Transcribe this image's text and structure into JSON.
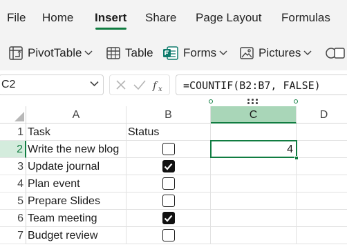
{
  "tabs": [
    {
      "label": "File",
      "active": false
    },
    {
      "label": "Home",
      "active": false
    },
    {
      "label": "Insert",
      "active": true
    },
    {
      "label": "Share",
      "active": false
    },
    {
      "label": "Page Layout",
      "active": false
    },
    {
      "label": "Formulas",
      "active": false
    }
  ],
  "ribbon": {
    "pivot_label": "PivotTable",
    "table_label": "Table",
    "forms_label": "Forms",
    "pictures_label": "Pictures"
  },
  "formula_bar": {
    "name_box": "C2",
    "formula": "=COUNTIF(B2:B7, FALSE)"
  },
  "grid": {
    "columns": [
      "A",
      "B",
      "C",
      "D"
    ],
    "selected_column": "C",
    "rows": [
      {
        "num": "1",
        "a": "Task",
        "b_text": "Status",
        "b_checkbox": null,
        "c": ""
      },
      {
        "num": "2",
        "a": "Write the new blog",
        "b_text": "",
        "b_checkbox": false,
        "c": "4"
      },
      {
        "num": "3",
        "a": "Update journal",
        "b_text": "",
        "b_checkbox": true,
        "c": ""
      },
      {
        "num": "4",
        "a": "Plan event",
        "b_text": "",
        "b_checkbox": false,
        "c": ""
      },
      {
        "num": "5",
        "a": "Prepare Slides",
        "b_text": "",
        "b_checkbox": false,
        "c": ""
      },
      {
        "num": "6",
        "a": "Team meeting",
        "b_text": "",
        "b_checkbox": true,
        "c": ""
      },
      {
        "num": "7",
        "a": "Budget review",
        "b_text": "",
        "b_checkbox": false,
        "c": ""
      }
    ],
    "active_row": "2"
  },
  "colors": {
    "accent": "#107c41",
    "selected_header": "#a9d6b8",
    "ribbon_bg": "#f3f3f3"
  }
}
